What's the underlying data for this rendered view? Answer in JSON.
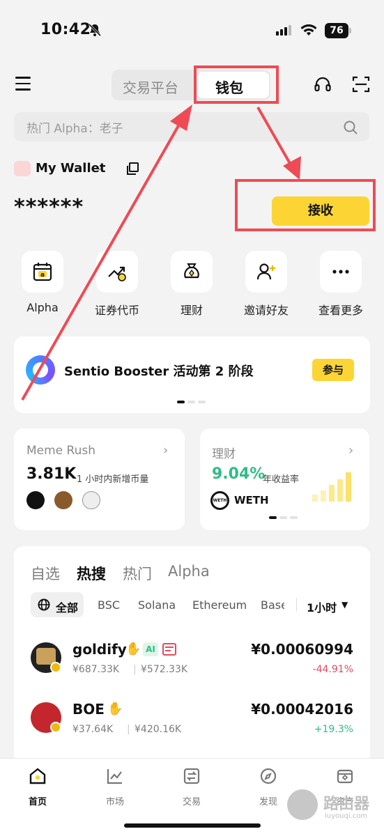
{
  "status_bar": {
    "time": "10:42",
    "battery": "76"
  },
  "header": {
    "tabs": [
      "交易平台",
      "钱包"
    ],
    "active_tab": "钱包"
  },
  "search": {
    "placeholder": "热门 Alpha：老子"
  },
  "wallet": {
    "name": "My Wallet",
    "balance": "******",
    "receive_label": "接收"
  },
  "shortcuts": [
    {
      "label": "Alpha",
      "icon": "alpha-calendar-icon"
    },
    {
      "label": "证券代币",
      "icon": "securities-chart-icon"
    },
    {
      "label": "理财",
      "icon": "money-bag-icon"
    },
    {
      "label": "邀请好友",
      "icon": "invite-user-icon"
    },
    {
      "label": "查看更多",
      "icon": "more-icon"
    }
  ],
  "banner": {
    "title": "Sentio Booster 活动第 2 阶段",
    "button": "参与"
  },
  "meme_card": {
    "title": "Meme Rush",
    "value": "3.81K",
    "caption": "1 小时内新增币量"
  },
  "finance_card": {
    "title": "理财",
    "rate": "9.04%",
    "caption": "年收益率",
    "asset": "WETH",
    "asset_icon_text": "WETH"
  },
  "market": {
    "tabs": [
      "自选",
      "热搜",
      "热门",
      "Alpha"
    ],
    "active_tab": "热搜",
    "chains": [
      "全部",
      "BSC",
      "Solana",
      "Ethereum",
      "Base"
    ],
    "timeframe": "1小时",
    "rows": [
      {
        "name": "goldify",
        "badge_ai": "AI",
        "sub1": "¥687.33K",
        "sub2": "¥572.33K",
        "price": "¥0.00060994",
        "change": "-44.91%",
        "change_color": "#e14a5e"
      },
      {
        "name": "BOE",
        "sub1": "¥37.64K",
        "sub2": "¥420.16K",
        "price": "¥0.00042016",
        "change": "+19.3%",
        "change_color": "#2ebd85"
      }
    ]
  },
  "bottom_nav": [
    {
      "label": "首页",
      "icon": "home-icon",
      "active": true
    },
    {
      "label": "市场",
      "icon": "market-chart-icon",
      "active": false
    },
    {
      "label": "交易",
      "icon": "trade-icon",
      "active": false
    },
    {
      "label": "发现",
      "icon": "discover-icon",
      "active": false
    },
    {
      "label": "资产",
      "icon": "assets-wallet-icon",
      "active": false
    }
  ],
  "watermark": {
    "text": "路由器",
    "sub": "luyouqi.com"
  },
  "colors": {
    "accent_yellow": "#fcd535",
    "annotation_red": "#ee4b55",
    "up_green": "#2ebd85",
    "down_red": "#e14a5e"
  }
}
